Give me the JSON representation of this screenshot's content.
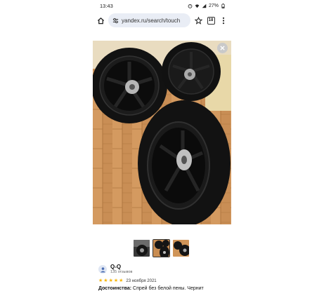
{
  "status_bar": {
    "time": "13:43",
    "battery": "27%"
  },
  "browser": {
    "url": "yandex.ru/search/touch",
    "tab_count": "18"
  },
  "gallery": {
    "thumbnail_count": 3,
    "active_thumbnail": 2
  },
  "review": {
    "author": "Q-Q",
    "review_count": "135 отзывов",
    "rating": 5,
    "date": "23 ноября 2021",
    "text_label": "Достоинства:",
    "text": " Спрей без белой пены. Чернит"
  },
  "colors": {
    "star": "#f6b60c",
    "url_bar": "#e9edf5"
  }
}
